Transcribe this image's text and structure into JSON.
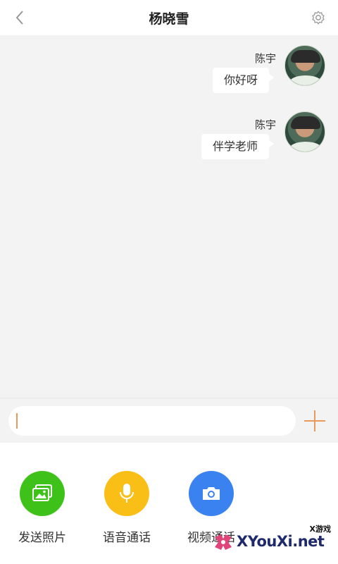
{
  "header": {
    "title": "杨晓雪",
    "back_icon": "chevron-left-icon",
    "settings_icon": "gear-icon"
  },
  "messages": [
    {
      "sender": "陈宇",
      "text": "你好呀"
    },
    {
      "sender": "陈宇",
      "text": "伴学老师"
    }
  ],
  "composer": {
    "placeholder": "",
    "value": "",
    "plus_icon": "plus-icon",
    "accent_color": "#e89a5c"
  },
  "actions": [
    {
      "label": "发送照片",
      "icon": "image-icon",
      "color": "#3ec21a"
    },
    {
      "label": "语音通话",
      "icon": "microphone-icon",
      "color": "#f9bf17"
    },
    {
      "label": "视频通话",
      "icon": "camera-icon",
      "color": "#3a82f0"
    }
  ],
  "watermark": {
    "brand": "XYouXi.net",
    "tag": "X游戏"
  }
}
